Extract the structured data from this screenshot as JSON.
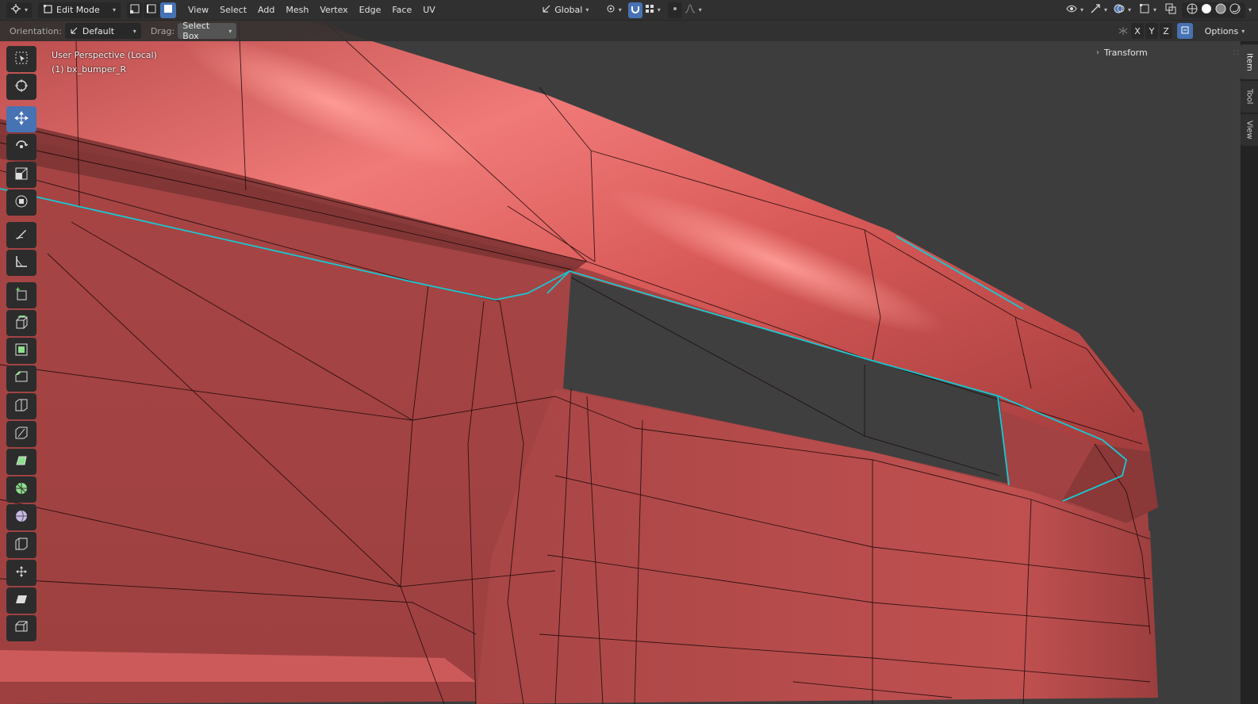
{
  "header": {
    "mode_label": "Edit Mode",
    "menus": [
      "View",
      "Select",
      "Add",
      "Mesh",
      "Vertex",
      "Edge",
      "Face",
      "UV"
    ],
    "transform_orientation": "Global"
  },
  "tool_header": {
    "orientation_label": "Orientation:",
    "orientation_value": "Default",
    "drag_label": "Drag:",
    "drag_value": "Select Box",
    "axis_x": "X",
    "axis_y": "Y",
    "axis_z": "Z",
    "options_label": "Options"
  },
  "viewport": {
    "perspective": "User Perspective (Local)",
    "object": "(1) bx_bumper_R"
  },
  "npanel": {
    "tabs": [
      "Item",
      "Tool",
      "View"
    ],
    "transform_label": "Transform"
  },
  "toolbar": {
    "tools": [
      "select-box",
      "cursor",
      "move",
      "rotate",
      "scale",
      "transform",
      "annotate",
      "measure",
      "add-cube",
      "extrude",
      "inset",
      "bevel",
      "loop-cut",
      "knife",
      "poly-build",
      "spin",
      "smooth",
      "edge-slide",
      "shrink-fatten",
      "shear",
      "rip-region"
    ]
  },
  "colors": {
    "mesh": "#b04a4a",
    "highlight": "#ee6a6a",
    "wire": "#1a0a0a",
    "seam": "#19c8d2",
    "accent": "#4772b3"
  }
}
